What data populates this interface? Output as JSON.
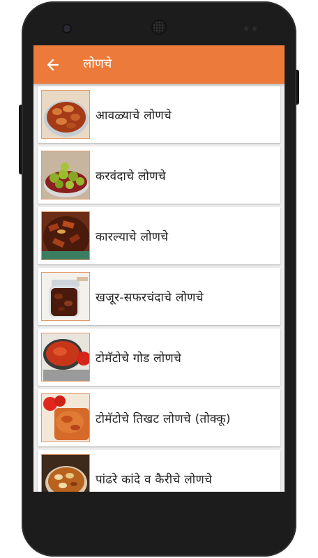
{
  "appbar": {
    "title": "लोणचे",
    "back_icon": "arrow-back-icon",
    "background": "#ec7a3b"
  },
  "items": [
    {
      "label": "आवळ्याचे लोणचे",
      "image": "amla-pickle-photo"
    },
    {
      "label": "करवंदाचे लोणचे",
      "image": "karvanda-pickle-photo"
    },
    {
      "label": "कारल्याचे लोणचे",
      "image": "bitter-gourd-pickle-photo"
    },
    {
      "label": "खजूर-सफरचंदाचे लोणचे",
      "image": "date-apple-pickle-photo"
    },
    {
      "label": "टोमॅटोचे गोड लोणचे",
      "image": "sweet-tomato-pickle-photo"
    },
    {
      "label": "टोमॅटोचे तिखट लोणचे (तोक्कू)",
      "image": "spicy-tomato-thokku-photo"
    },
    {
      "label": "पांढरे कांदे व कैरीचे लोणचे",
      "image": "onion-mango-pickle-photo"
    }
  ]
}
